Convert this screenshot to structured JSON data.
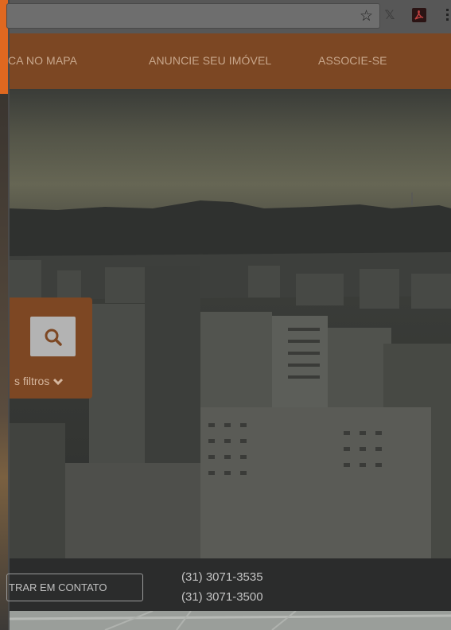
{
  "browser": {
    "bookmark_icon": "star-icon",
    "extension_icons": [
      "x-extension-icon",
      "pdf-extension-icon"
    ],
    "menu_icon": "menu-dots-icon"
  },
  "nav": {
    "items": [
      {
        "label": "CA NO MAPA"
      },
      {
        "label": "ANUNCIE SEU IMÓVEL"
      },
      {
        "label": "ASSOCIE-SE"
      }
    ]
  },
  "search": {
    "icon": "search-icon",
    "filters_label": "s filtros"
  },
  "contact": {
    "button_label": "TRAR EM CONTATO",
    "phones": [
      "(31) 3071-3535",
      "(31) 3071-3500"
    ]
  },
  "colors": {
    "brand_orange": "#e06820",
    "nav_bg_dimmed": "#7c4723"
  }
}
